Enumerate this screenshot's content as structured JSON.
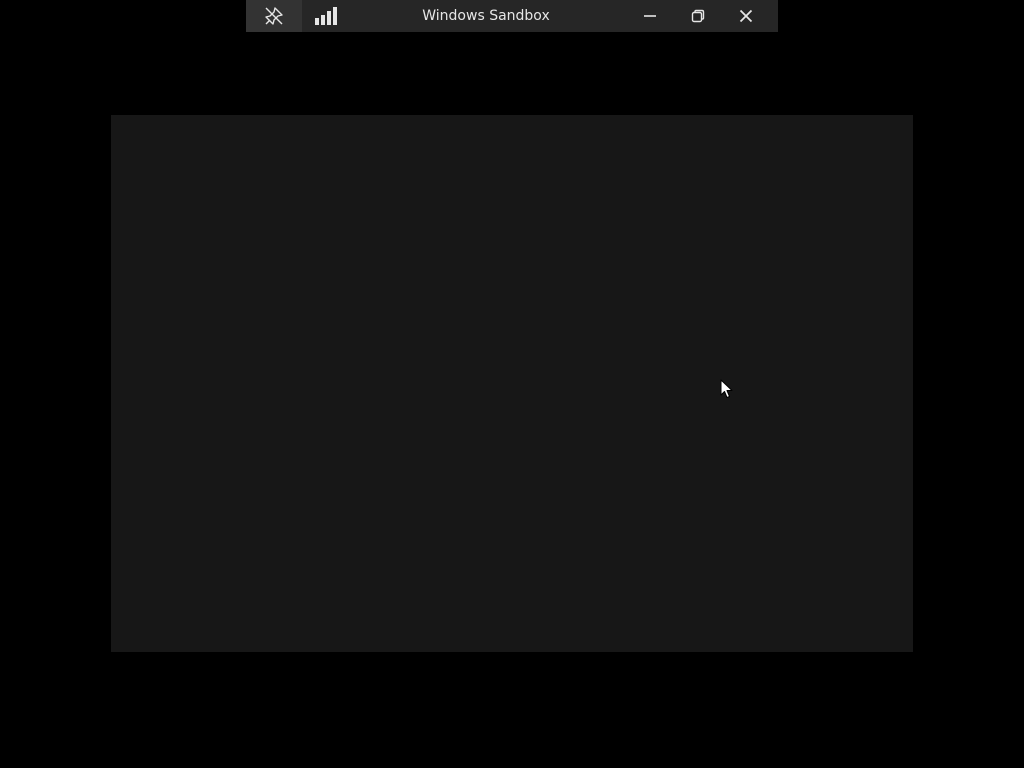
{
  "connection_bar": {
    "title": "Windows Sandbox",
    "icons": {
      "pin": "unpin-icon",
      "signal": "connection-signal-icon",
      "minimize": "minimize-icon",
      "restore": "restore-icon",
      "close": "close-icon"
    }
  },
  "vm_window": {
    "background_color": "#171717"
  },
  "colors": {
    "bar_background": "#262626",
    "desktop_background": "#000000",
    "icon_color": "#e6e6e6"
  }
}
